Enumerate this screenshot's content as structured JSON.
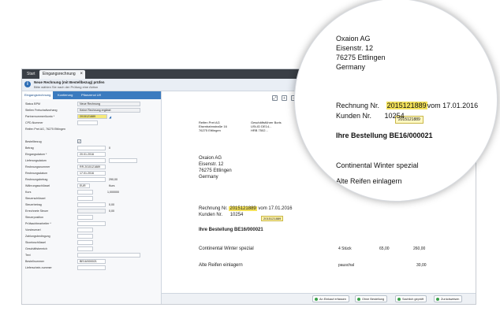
{
  "window": {
    "tabs": [
      {
        "label": "Start"
      },
      {
        "label": "Eingangsrechnung"
      }
    ],
    "close_glyph": "×"
  },
  "infobar": {
    "title": "Neue Rechnung (mit Bestellbezug) prüfen",
    "subtitle": "Bitte wählen Sie nach der Prüfung eine Aktion"
  },
  "left_tabs": [
    {
      "label": "Eingangsrechnung"
    },
    {
      "label": "Kontierung"
    },
    {
      "label": "Pflanzenol Ulf"
    }
  ],
  "form": [
    {
      "label": "Status BPM",
      "value": "Neue Rechnung"
    },
    {
      "label": "Stellen Freischaltvorhang",
      "value": "Keine Rechnung ergänzt"
    },
    {
      "label": "Partnernummer/konto *",
      "value": "2015121889"
    },
    {
      "label": "CPD-Nummer",
      "value": ""
    },
    {
      "label": "Reifen Pret AG, 76275 Ettlingen",
      "value": ""
    },
    {
      "label": "Bestellbezug",
      "value": "✓"
    },
    {
      "label": "Betrag",
      "value": "0"
    },
    {
      "label": "Eingangsdatum *",
      "value": "20.01.2016"
    },
    {
      "label": "Lieferungsdatum",
      "value": ""
    },
    {
      "label": "Rechnungsnummer",
      "value": "RR.2015121889"
    },
    {
      "label": "Rechnungsdatum",
      "value": "17.01.2016"
    },
    {
      "label": "Rechnungsbetrag",
      "value": "290,00"
    },
    {
      "label": "Währungsschlüssel",
      "value": "EUR"
    },
    {
      "label": "Kurs",
      "value": "1,000000"
    },
    {
      "label": "Steuerschlüssel",
      "value": ""
    },
    {
      "label": "Steuerbetrag",
      "value": "0,00"
    },
    {
      "label": "Errechnete Steuer",
      "value": "0,00"
    },
    {
      "label": "Steuerposition",
      "value": ""
    },
    {
      "label": "Prüfsachbearbeiter *",
      "value": ""
    },
    {
      "label": "Vorsteuerart",
      "value": ""
    },
    {
      "label": "Zahlungsbedingung",
      "value": ""
    },
    {
      "label": "Skontoschlüssel",
      "value": ""
    },
    {
      "label": "Geschäftsbereich",
      "value": ""
    },
    {
      "label": "Text",
      "value": ""
    },
    {
      "label": "Bestellnummer",
      "value": "BE16/000021"
    },
    {
      "label": "Lieferschein-nummer",
      "value": ""
    }
  ],
  "extra": {
    "kurs_label": "Kurs",
    "betrag_cents": "290,00"
  },
  "toolbar_icons": [
    "expand-icon",
    "zoom-in-icon",
    "zoom-out-icon",
    "fit-icon"
  ],
  "document": {
    "small_header_left": [
      "Reifen Pret AG",
      "Eisenbahnstraße 16",
      "76275 Ettlingen"
    ],
    "small_header_right": [
      "Geschäftsführer Boris",
      "USt-ID DE14...",
      "HRB 7502..."
    ],
    "address": [
      "Oxaion AG",
      "Eisenstr. 12",
      "76275 Ettlingen",
      "Germany"
    ],
    "invoice_label": "Rechnung Nr.",
    "invoice_number": "2015121889",
    "invoice_date_text": "vom 17.01.2016",
    "customer_label": "Kunden Nr.",
    "customer_number": "10254",
    "tooltip": "2015121889",
    "order_text": "Ihre Bestellung BE16/000021",
    "line1": {
      "desc": "Continental Winter spezial",
      "qty": "4 Stück",
      "price": "65,00",
      "total": "260,00"
    },
    "line2": {
      "desc": "Alte Reifen einlagern",
      "qty": "pauschal",
      "total": "30,00"
    }
  },
  "footer_buttons": [
    {
      "label": "An Einkauf erfassen"
    },
    {
      "label": "Ohne Bestellung"
    },
    {
      "label": "Sachlich geprüft"
    },
    {
      "label": "Zurückweisen"
    }
  ]
}
